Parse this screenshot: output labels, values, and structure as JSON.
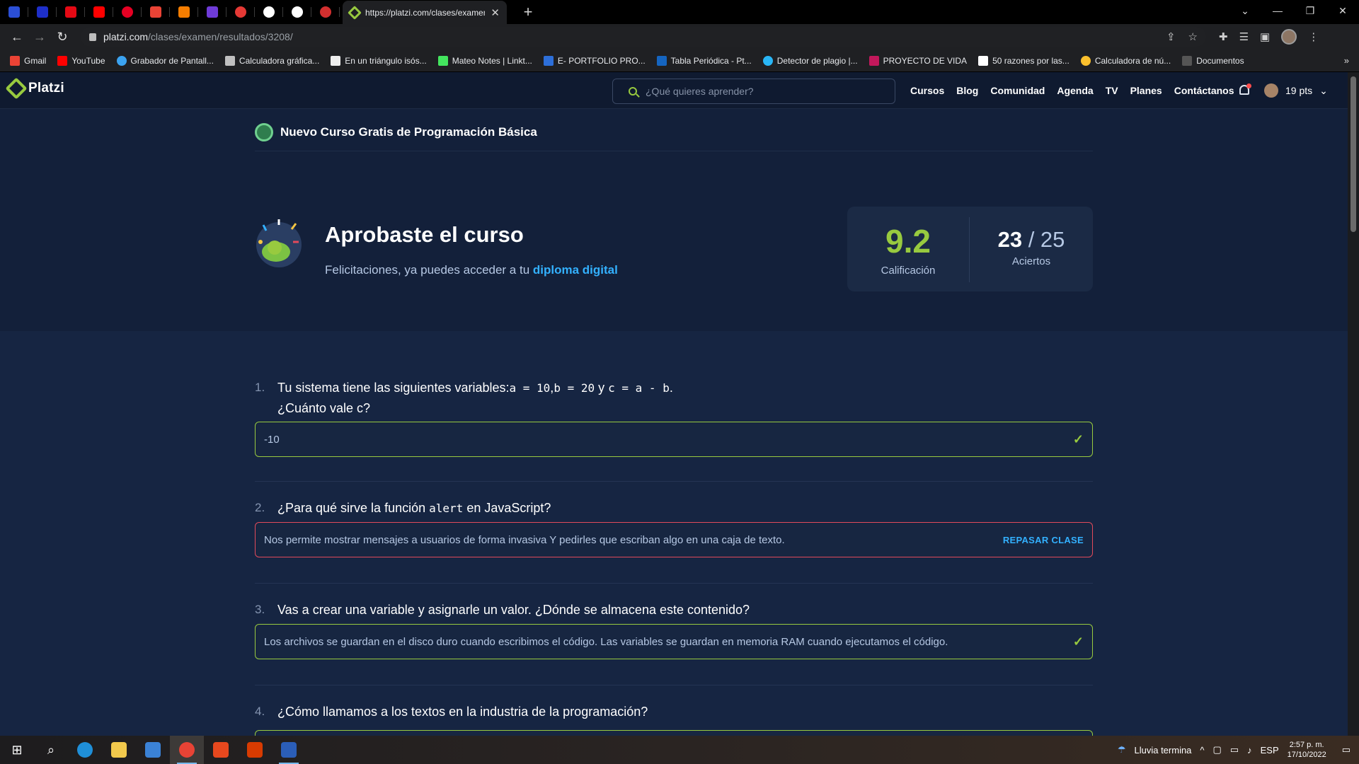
{
  "browser": {
    "active_tab_title": "https://platzi.com/clases/examen",
    "url_host": "platzi.com",
    "url_path": "/clases/examen/resultados/3208/",
    "bookmarks": [
      "Gmail",
      "YouTube",
      "Grabador de Pantall...",
      "Calculadora gráfica...",
      "En un triángulo isós...",
      "Mateo Notes | Linkt...",
      "E- PORTFOLIO PRO...",
      "Tabla Periódica - Pt...",
      "Detector de plagio |...",
      "PROYECTO DE VIDA",
      "50 razones por las...",
      "Calculadora de nú...",
      "Documentos"
    ]
  },
  "navbar": {
    "logo": "Platzi",
    "search_placeholder": "¿Qué quieres aprender?",
    "menu": [
      "Cursos",
      "Blog",
      "Comunidad",
      "Agenda",
      "TV",
      "Planes",
      "Contáctanos"
    ],
    "points": "19 pts"
  },
  "banner": {
    "text": "Nuevo Curso Gratis de Programación Básica"
  },
  "hero": {
    "title": "Aprobaste el curso",
    "subtitle": "Felicitaciones, ya puedes acceder a tu",
    "link": "diploma digital"
  },
  "score": {
    "grade": "9.2",
    "grade_label": "Calificación",
    "correct": "23",
    "total": "/ 25",
    "correct_label": "Aciertos"
  },
  "questions": [
    {
      "num": "1.",
      "text_a": "Tu sistema tiene las siguientes variables:",
      "code_a": "a = 10",
      "sep_a": ",",
      "code_b": "b = 20",
      "sep_b": " y ",
      "code_c": "c = a - b",
      "end": ".",
      "line2": "¿Cuánto vale c?",
      "answer": "-10"
    },
    {
      "num": "2.",
      "text_a": "¿Para qué sirve la función",
      "code": "alert",
      "text_b": "en JavaScript?",
      "answer": "Nos permite mostrar mensajes a usuarios de forma invasiva Y pedirles que escriban algo en una caja de texto.",
      "action": "REPASAR CLASE"
    },
    {
      "num": "3.",
      "text": "Vas a crear una variable y asignarle un valor. ¿Dónde se almacena este contenido?",
      "answer": "Los archivos se guardan en el disco duro cuando escribimos el código. Las variables se guardan en memoria RAM cuando ejecutamos el código."
    },
    {
      "num": "4.",
      "text": "¿Cómo llamamos a los textos en la industria de la programación?"
    }
  ],
  "taskbar": {
    "weather": "Lluvia termina",
    "lang": "ESP",
    "time": "2:57 p. m.",
    "date": "17/10/2022"
  },
  "colors": {
    "accent": "#98ca3f",
    "link": "#33b1ff",
    "error": "#e24a5b",
    "bg": "#13203a"
  }
}
